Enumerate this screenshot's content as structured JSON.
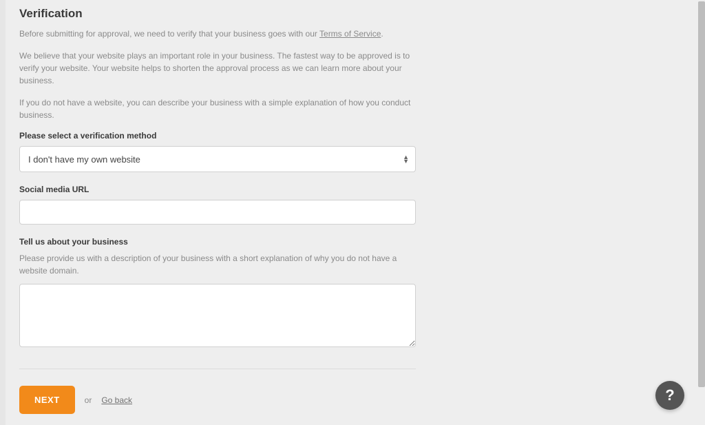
{
  "title": "Verification",
  "intro": {
    "p1_before_link": "Before submitting for approval, we need to verify that your business goes with our ",
    "tos_link_text": "Terms of Service",
    "p1_after_link": ".",
    "p2": "We believe that your website plays an important role in your business. The fastest way to be approved is to verify your website. Your website helps to shorten the approval process as we can learn more about your business.",
    "p3": "If you do not have a website, you can describe your business with a simple explanation of how you conduct business."
  },
  "fields": {
    "method": {
      "label": "Please select a verification method",
      "selected": "I don't have my own website"
    },
    "social": {
      "label": "Social media URL",
      "value": ""
    },
    "business": {
      "label": "Tell us about your business",
      "help": "Please provide us with a description of your business with a short explanation of why you do not have a website domain.",
      "value": ""
    }
  },
  "actions": {
    "next": "NEXT",
    "or": "or",
    "back": "Go back"
  },
  "help_fab": "?"
}
